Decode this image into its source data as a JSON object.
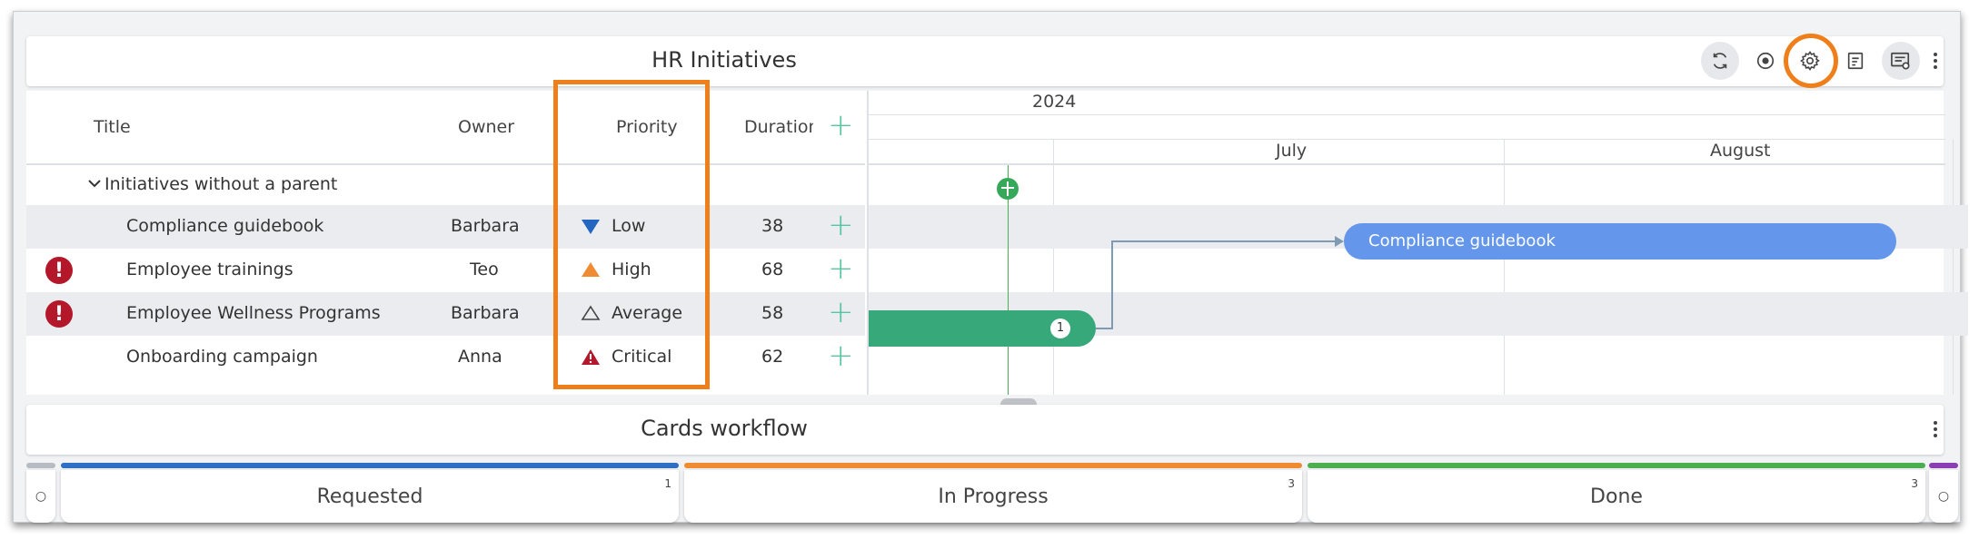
{
  "gantt": {
    "title": "HR Initiatives",
    "toolbar": {
      "icons": [
        "refresh-icon",
        "target-icon",
        "gear-icon",
        "notes-icon",
        "card-settings-icon",
        "more-vertical-icon"
      ]
    },
    "columns": {
      "title": "Title",
      "owner": "Owner",
      "priority": "Priority",
      "duration": "Duration"
    },
    "timeline": {
      "year": "2024",
      "months": [
        "July",
        "August"
      ]
    },
    "group": {
      "label": "Initiatives without a parent"
    },
    "rows": [
      {
        "title": "Compliance guidebook",
        "owner": "Barbara",
        "priority": "Low",
        "priority_icon": "triangle-down-blue-icon",
        "duration": "38",
        "alert": false
      },
      {
        "title": "Employee trainings",
        "owner": "Teo",
        "priority": "High",
        "priority_icon": "triangle-up-orange-icon",
        "duration": "68",
        "alert": true
      },
      {
        "title": "Employee Wellness Programs",
        "owner": "Barbara",
        "priority": "Average",
        "priority_icon": "triangle-outline-icon",
        "duration": "58",
        "alert": true
      },
      {
        "title": "Onboarding campaign",
        "owner": "Anna",
        "priority": "Critical",
        "priority_icon": "warning-triangle-red-icon",
        "duration": "62",
        "alert": false
      }
    ],
    "bars": {
      "compliance_label": "Compliance guidebook",
      "wellness_badge": "1"
    },
    "alert_glyph": "!"
  },
  "workflow": {
    "title": "Cards workflow",
    "columns": [
      {
        "label": "Requested",
        "count": "1",
        "color": "#2d6fc4"
      },
      {
        "label": "In Progress",
        "count": "3",
        "color": "#ef8c33"
      },
      {
        "label": "Done",
        "count": "3",
        "color": "#4cae4f"
      }
    ]
  },
  "colors": {
    "highlight": "#ef7f1a",
    "bar_blue": "#6496ec",
    "bar_green": "#36a87a",
    "plus": "#58c5a2",
    "alert": "#b4162a"
  }
}
